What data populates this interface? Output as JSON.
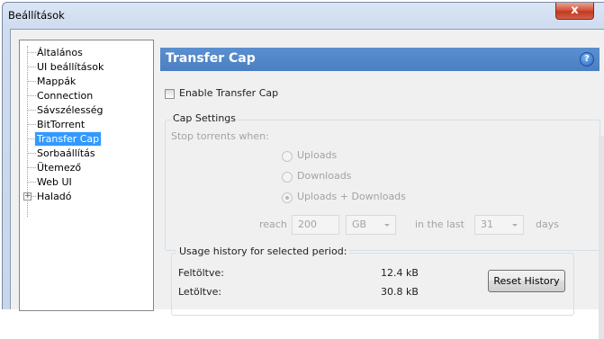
{
  "window": {
    "title": "Beállítások",
    "close_glyph": "x"
  },
  "tree": {
    "items": [
      {
        "label": "Általános"
      },
      {
        "label": "UI beállítások"
      },
      {
        "label": "Mappák"
      },
      {
        "label": "Connection"
      },
      {
        "label": "Sávszélesség"
      },
      {
        "label": "BitTorrent"
      },
      {
        "label": "Transfer Cap",
        "selected": true
      },
      {
        "label": "Sorbaállítás"
      },
      {
        "label": "Ütemező"
      },
      {
        "label": "Web UI"
      },
      {
        "label": "Haladó",
        "expandable": true,
        "expander_glyph": "+"
      }
    ]
  },
  "panel": {
    "title": "Transfer Cap",
    "help_glyph": "?",
    "enable_label": "Enable Transfer Cap",
    "enable_checked": false,
    "cap_settings": {
      "group_label": "Cap Settings",
      "stop_label": "Stop torrents when:",
      "options": [
        "Uploads",
        "Downloads",
        "Uploads + Downloads"
      ],
      "selected_option": "Uploads + Downloads",
      "reach_label": "reach",
      "reach_value": "200",
      "unit_value": "GB",
      "in_last_label": "in the last",
      "days_value": "31",
      "days_label": "days"
    },
    "usage": {
      "group_label": "Usage history for selected period:",
      "uploaded_label": "Feltöltve:",
      "uploaded_value": "12.4 kB",
      "downloaded_label": "Letöltve:",
      "downloaded_value": "30.8 kB",
      "reset_label": "Reset History"
    }
  },
  "colors": {
    "header_bg": "#4a7fc2",
    "selection": "#3399ff",
    "close_button": "#c8452a"
  }
}
